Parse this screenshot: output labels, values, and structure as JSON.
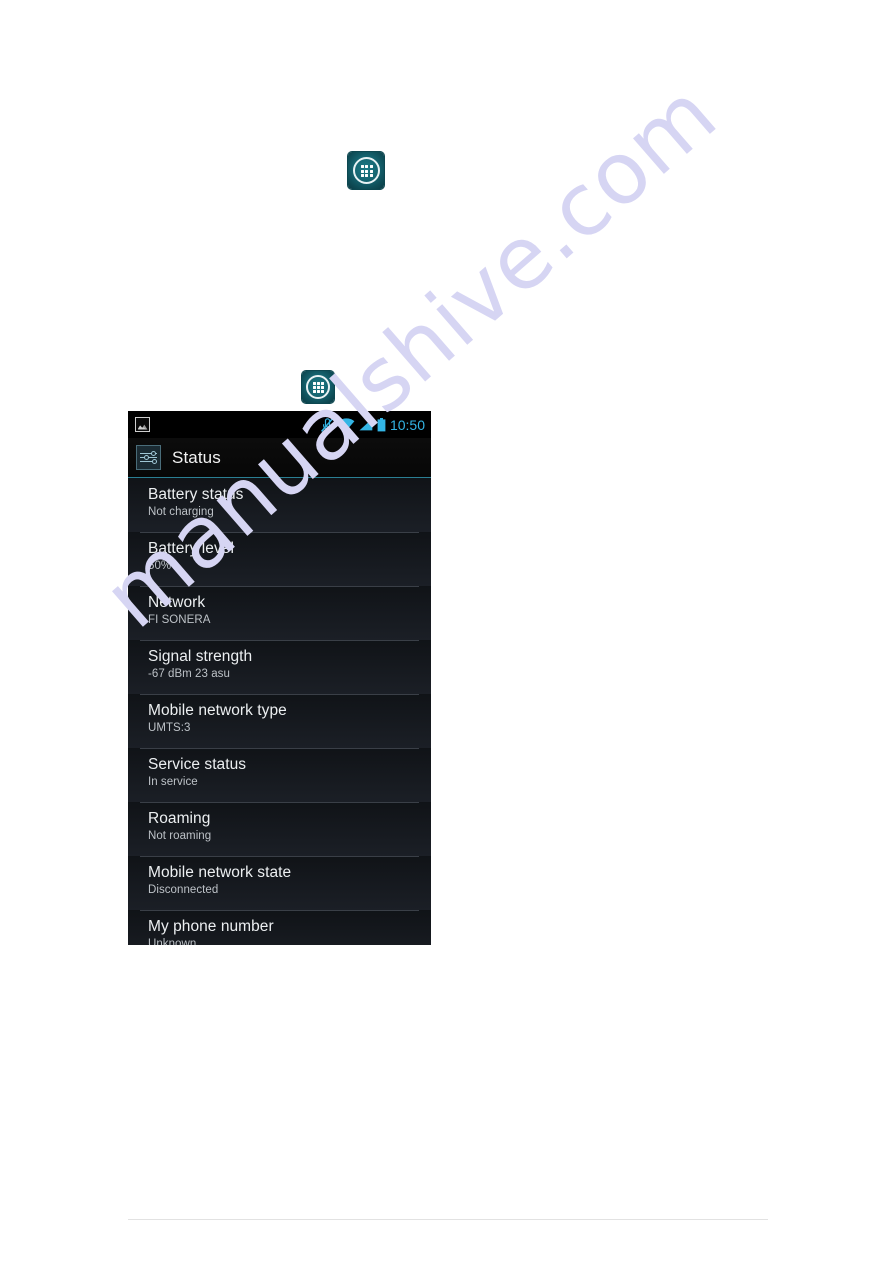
{
  "page": {
    "background_color": "#ffffff",
    "watermark": "manualshive.com",
    "watermark_color": "#d6d5f3"
  },
  "drawer_icons": [
    {
      "name": "all-apps-drawer-icon",
      "label": "Apps"
    },
    {
      "name": "all-apps-drawer-icon",
      "label": "Apps"
    }
  ],
  "phone_screenshot": {
    "status_bar": {
      "notification_icon": "screenshot-image-icon",
      "icons": [
        "vibrate-muted-icon",
        "wifi-icon",
        "cellular-signal-icon",
        "battery-icon"
      ],
      "time": "10:50",
      "accent_color": "#33b5e5"
    },
    "action_bar": {
      "icon": "settings-sliders-icon",
      "title": "Status",
      "underline_color": "#2a7f93"
    },
    "rows": [
      {
        "label": "Battery status",
        "value": "Not charging"
      },
      {
        "label": "Battery level",
        "value": "50%"
      },
      {
        "label": "Network",
        "value": "FI SONERA"
      },
      {
        "label": "Signal strength",
        "value": "-67 dBm   23 asu"
      },
      {
        "label": "Mobile network type",
        "value": "UMTS:3"
      },
      {
        "label": "Service status",
        "value": "In service"
      },
      {
        "label": "Roaming",
        "value": "Not roaming"
      },
      {
        "label": "Mobile network state",
        "value": "Disconnected"
      },
      {
        "label": "My phone number",
        "value": "Unknown"
      }
    ]
  }
}
